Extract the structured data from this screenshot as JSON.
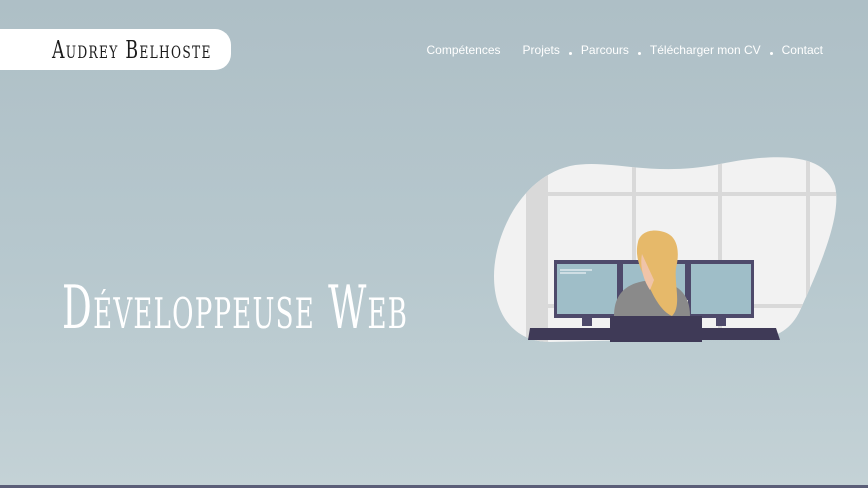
{
  "header": {
    "logo_text": "Audrey Belhoste",
    "nav": [
      {
        "label": "Compétences"
      },
      {
        "label": "Projets"
      },
      {
        "label": "Parcours"
      },
      {
        "label": "Télécharger mon CV"
      },
      {
        "label": "Contact"
      }
    ]
  },
  "hero": {
    "title": "Développeuse Web"
  },
  "colors": {
    "background_top": "#aebfc6",
    "background_bottom": "#c4d2d6",
    "blob": "#f2f2f2",
    "monitor_frame": "#4e4a6b",
    "monitor_screen": "#9fbec8",
    "hair": "#e6b96a",
    "desk": "#3f3a57"
  },
  "icons": [
    "developer-illustration"
  ]
}
